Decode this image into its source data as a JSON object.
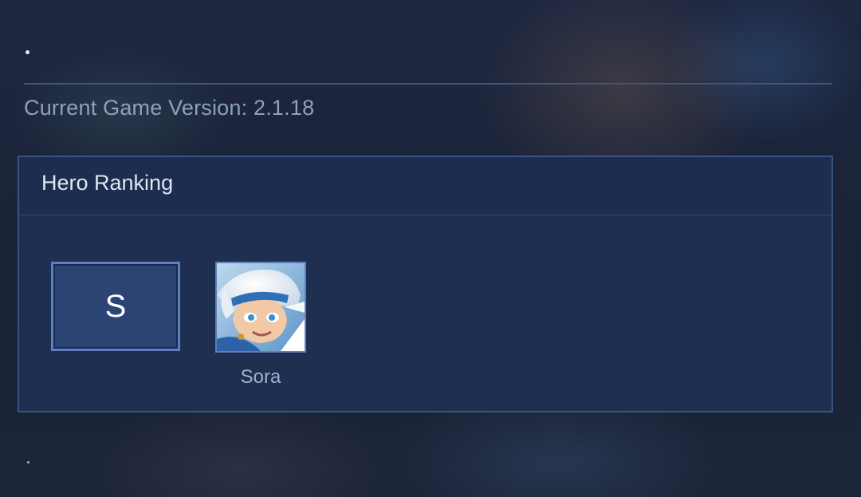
{
  "version": {
    "label": "Current Game Version: 2.1.18"
  },
  "ranking": {
    "title": "Hero Ranking",
    "tiers": [
      {
        "tier": "S",
        "heroes": [
          {
            "name": "Sora",
            "icon": "sora-portrait"
          }
        ]
      }
    ]
  },
  "colors": {
    "panel_bg": "#1f2f52",
    "panel_border": "#3a5383",
    "tier_box_bg": "#2c4474",
    "tier_box_border": "#5b7fc2",
    "version_text": "#8ba2c0"
  }
}
